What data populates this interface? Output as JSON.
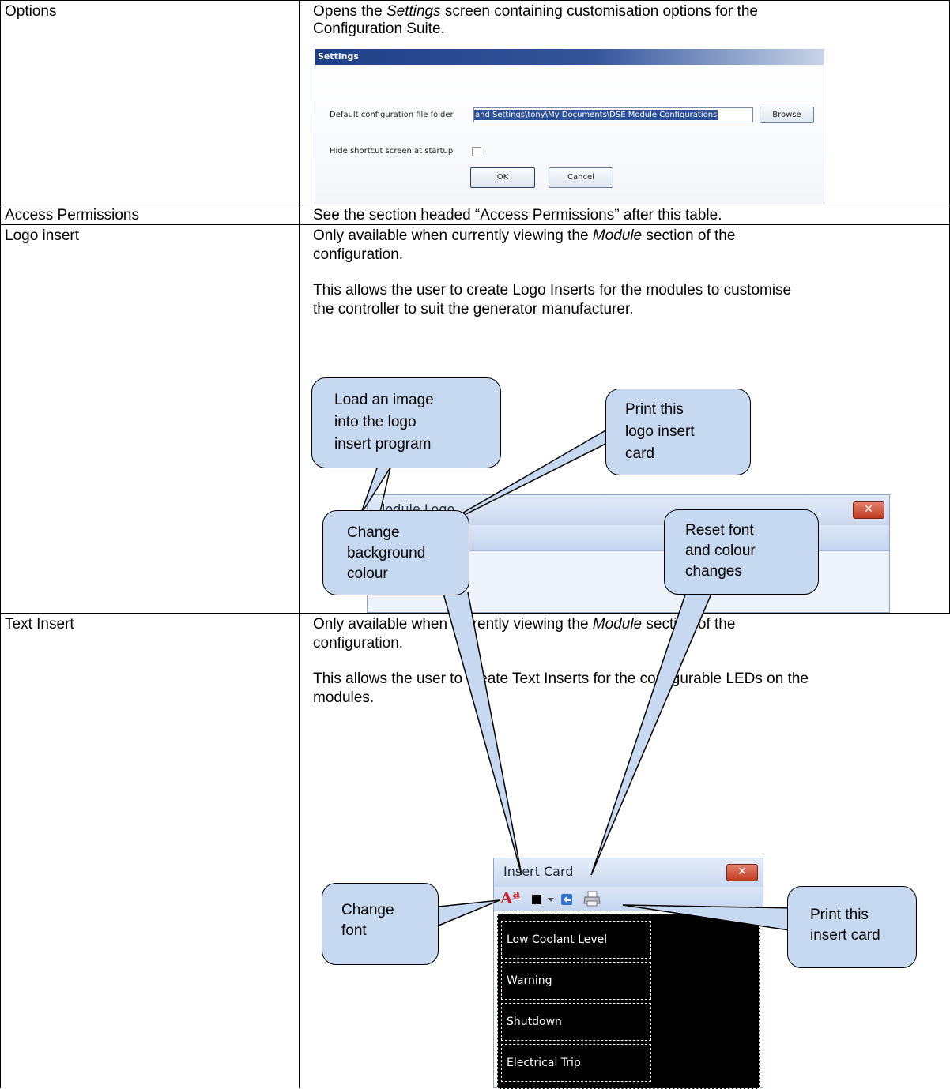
{
  "rows": [
    {
      "name": "Options",
      "desc_line1_before": "Opens the ",
      "desc_line1_em": "Settings",
      "desc_line1_after": " screen containing customisation options for the",
      "desc_line2": "Configuration Suite."
    },
    {
      "name": "Access Permissions",
      "desc": "See the section headed “Access Permissions” after this table."
    },
    {
      "name": "Logo insert",
      "p1_before": "Only available when currently viewing the ",
      "p1_em": "Module",
      "p1_after": " section of the",
      "p1_line2": "configuration.",
      "p2_line1": "This allows the user to create Logo Inserts for the modules to customise",
      "p2_line2": "the controller to suit the generator manufacturer."
    },
    {
      "name": "Text Insert",
      "p1_before": "Only available when currently viewing the ",
      "p1_em": "Module",
      "p1_after": " section of the",
      "p1_line2": "configuration.",
      "p2_line1": "This allows the user to create Text Inserts for the configurable LEDs on the",
      "p2_line2": "modules."
    }
  ],
  "settings_dialog": {
    "title": "Settings",
    "folder_label": "Default configuration file folder",
    "folder_value": "and Settings\\tony\\My Documents\\DSE Module Configurations",
    "browse_label": "Browse",
    "hide_shortcut_label": "Hide shortcut screen at startup",
    "hide_shortcut_checked": false,
    "ok_label": "OK",
    "cancel_label": "Cancel"
  },
  "logo_window": {
    "title": "lodule Logo",
    "close_label": "✕",
    "open_icon": "open-folder-icon",
    "print_icon": "printer-icon"
  },
  "logo_callouts": {
    "load": [
      "Load an image",
      "into the logo",
      "insert program"
    ],
    "print": [
      "Print this",
      "logo insert",
      "card"
    ]
  },
  "insert_window": {
    "title": "Insert Card",
    "close_label": "✕",
    "font_icon_text": "Aª",
    "items": [
      "Low Coolant Level",
      "Warning",
      "Shutdown",
      "Electrical Trip"
    ]
  },
  "insert_callouts": {
    "background": [
      "Change",
      "background",
      "colour"
    ],
    "reset": [
      "Reset font",
      "and colour",
      "changes"
    ],
    "font": [
      "Change",
      "font"
    ],
    "print": [
      "Print this",
      "insert card"
    ]
  },
  "colors": {
    "callout_fill": "#c6d9f1",
    "title_bar_dark": "#1f3f86",
    "close_button": "#c0391f"
  }
}
